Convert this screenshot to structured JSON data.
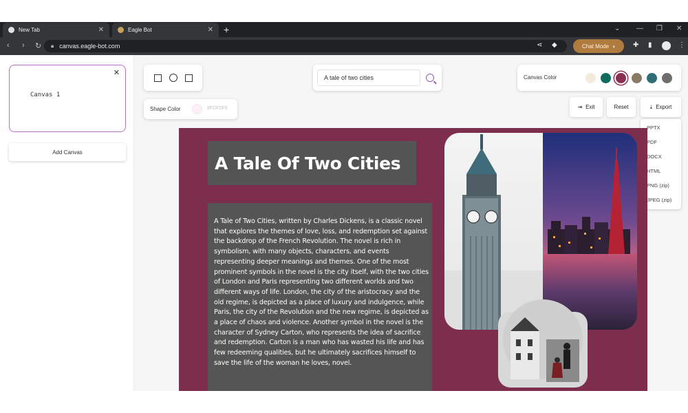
{
  "browser": {
    "tabs": [
      {
        "title": "New Tab",
        "active": false
      },
      {
        "title": "Eagle Bot",
        "active": true
      }
    ],
    "url": "canvas.eagle-bot.com",
    "chat_mode_label": "Chat Mode"
  },
  "sidebar": {
    "canvases": [
      {
        "label": "Canvas 1"
      }
    ],
    "add_canvas_label": "Add Canvas"
  },
  "toolbar": {
    "search_value": "A tale of two cities",
    "canvas_color_label": "Canvas Color",
    "canvas_colors": [
      "#f3eadb",
      "#0f6b5c",
      "#8b2f52",
      "#8a7a63",
      "#2f6e76",
      "#6e6e6e"
    ],
    "selected_canvas_color": "#8b2f52",
    "shape_color_label": "Shape Color",
    "shape_color_value": "#FDF0F9",
    "exit_label": "Exit",
    "reset_label": "Reset",
    "export_label": "Export",
    "export_options": [
      "PPTX",
      "PDF",
      "DOCX",
      "HTML",
      "PNG (zip)",
      "JPEG (zip)"
    ]
  },
  "slide": {
    "background": "#7e2e4d",
    "title": "A Tale Of Two Cities",
    "body": "A Tale of Two Cities, written by Charles Dickens, is a classic novel that explores the themes of love, loss, and redemption set against the backdrop of the French Revolution. The novel is rich in symbolism, with many objects, characters, and events representing deeper meanings and themes. One of the most prominent symbols in the novel is the city itself, with the two cities of London and Paris representing two different worlds and two different ways of life. London, the city of the aristocracy and the old regime, is depicted as a place of luxury and indulgence, while Paris, the city of the Revolution and the new regime, is depicted as a place of chaos and violence. Another symbol in the novel is the character of Sydney Carton, who represents the idea of sacrifice and redemption. Carton is a man who has wasted his life and has few redeeming qualities, but he ultimately sacrifices himself to save the life of the woman he loves, novel."
  }
}
